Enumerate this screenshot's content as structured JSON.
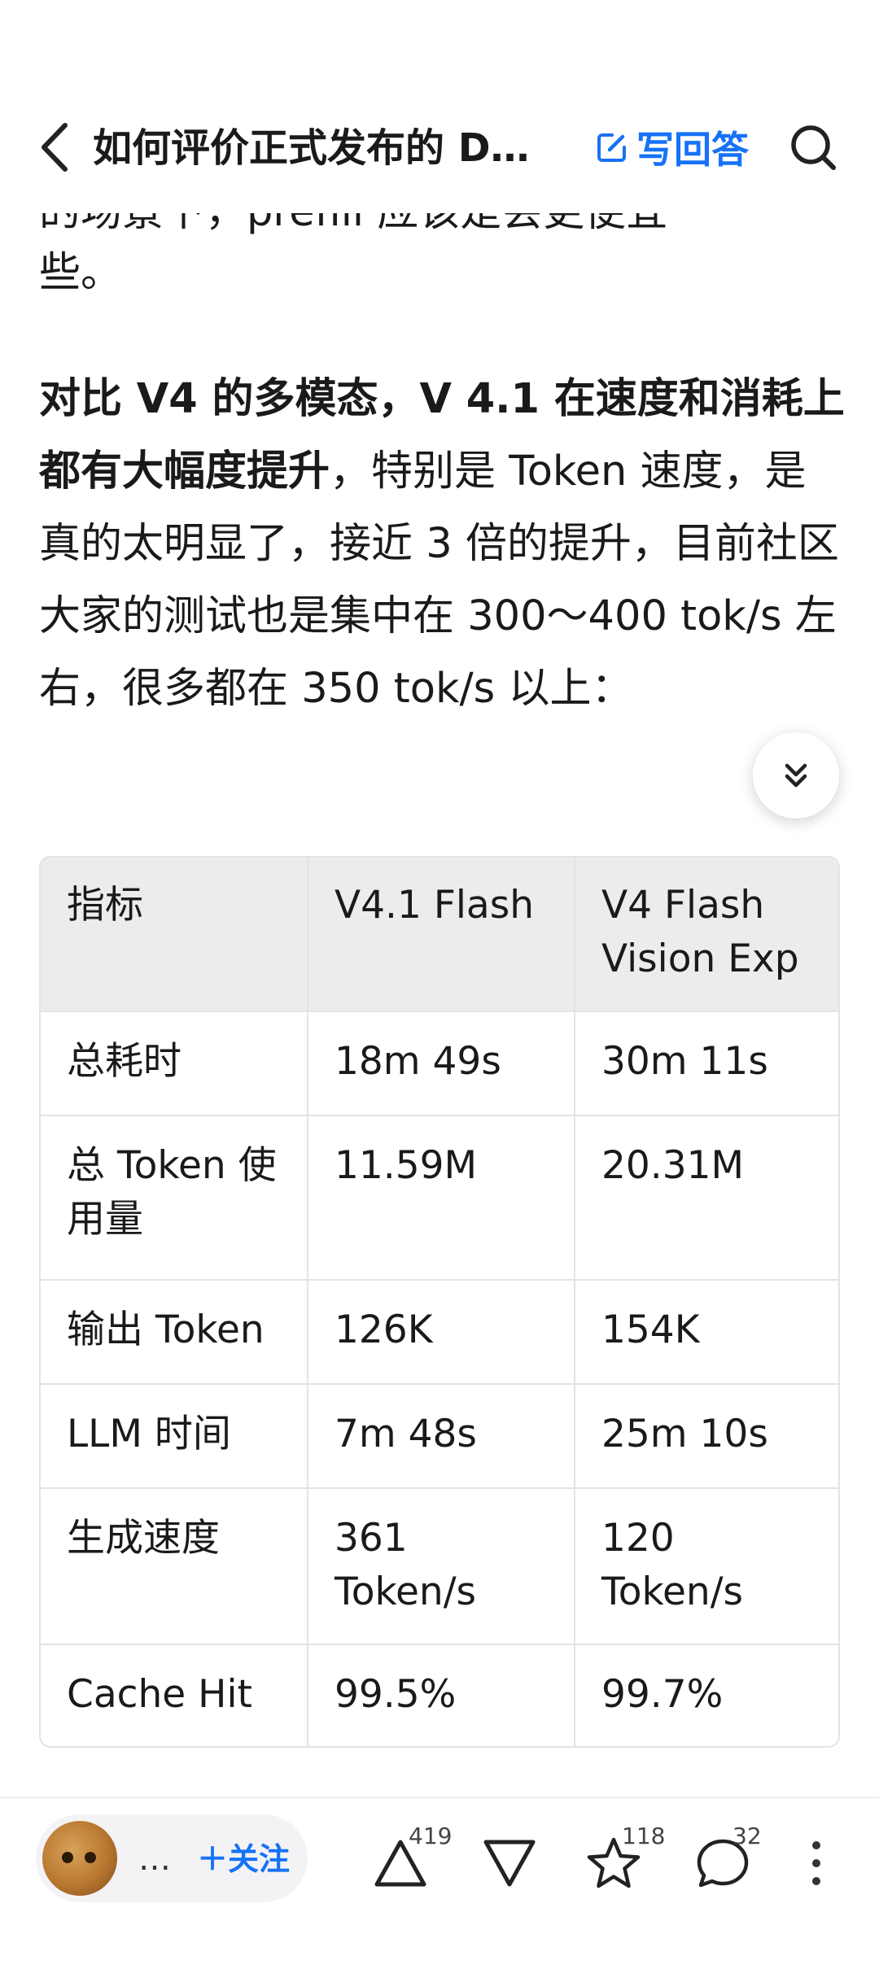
{
  "header": {
    "title": "如何评价正式发布的 D…",
    "write_answer_label": "写回答"
  },
  "article": {
    "cut_line": "的场景下，prefill 应该是会更便宜一",
    "tail_line": "些。",
    "para_bold": "对比 V4 的多模态，V 4.1 在速度和消耗上都有大幅度提升",
    "para_rest": "，特别是 Token 速度，是真的太明显了，接近 3 倍的提升，目前社区大家的测试也是集中在 300～400 tok/s 左右，很多都在 350 tok/s 以上："
  },
  "table": {
    "headers": [
      "指标",
      "V4.1 Flash",
      "V4 Flash Vision Exp"
    ],
    "rows": [
      [
        "总耗时",
        "18m 49s",
        "30m 11s"
      ],
      [
        "总 Token 使用量",
        "11.59M",
        "20.31M"
      ],
      [
        "输出 Token",
        "126K",
        "154K"
      ],
      [
        "LLM 时间",
        "7m 48s",
        "25m 10s"
      ],
      [
        "生成速度",
        "361 Token/s",
        "120 Token/s"
      ],
      [
        "Cache Hit",
        "99.5%",
        "99.7%"
      ]
    ]
  },
  "bottom_bar": {
    "author_name": "…",
    "follow_label": "＋关注",
    "upvote_count": "419",
    "favorite_count": "118",
    "comment_count": "32"
  },
  "colors": {
    "accent": "#1772f6",
    "table_header_bg": "#ececee",
    "border": "#e3e3e3"
  }
}
